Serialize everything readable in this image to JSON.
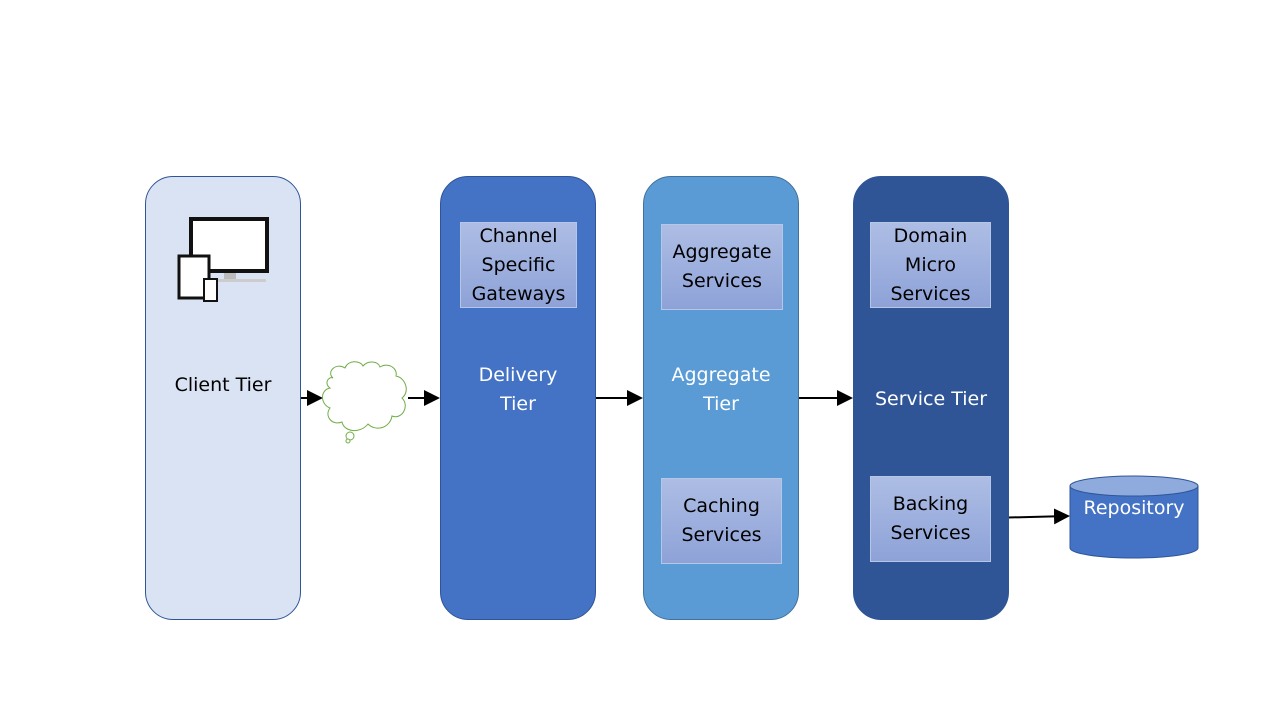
{
  "tiers": [
    {
      "label": "Client Tier",
      "color": "#dae3f3"
    },
    {
      "label": "Delivery\nTier",
      "color": "#4472c4"
    },
    {
      "label": "Aggregate\nTier",
      "color": "#5b9bd5"
    },
    {
      "label": "Service Tier",
      "color": "#2f5597"
    }
  ],
  "boxes": {
    "channel_gateways": "Channel\nSpecific\nGateways",
    "aggregate_services": "Aggregate\nServices",
    "caching_services": "Caching\nServices",
    "domain_micro_services": "Domain\nMicro\nServices",
    "backing_services": "Backing\nServices"
  },
  "repository": "Repository",
  "icons": {
    "client_devices": "devices-icon",
    "network": "cloud-icon",
    "repository": "database-cylinder-icon"
  }
}
